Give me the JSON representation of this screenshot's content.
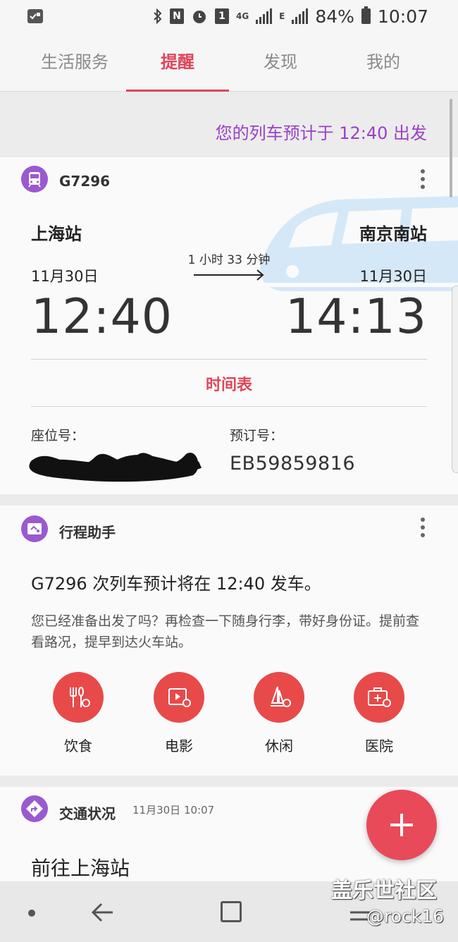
{
  "status_bar": {
    "battery": "84%",
    "time": "10:07",
    "sim_label": "1",
    "network": "4G",
    "edge_label": "E",
    "icons": [
      "notification-icon",
      "bluetooth-icon",
      "nfc-icon",
      "alarm-icon",
      "sim-icon",
      "signal-icon",
      "battery-icon"
    ]
  },
  "tabs": [
    {
      "label": "生活服务",
      "active": false
    },
    {
      "label": "提醒",
      "active": true
    },
    {
      "label": "发现",
      "active": false
    },
    {
      "label": "我的",
      "active": false
    }
  ],
  "banner": {
    "text": "您的列车预计于 12:40 出发"
  },
  "train_card": {
    "train_number": "G7296",
    "departure_station": "上海站",
    "arrival_station": "南京南站",
    "duration": "1 小时 33 分钟",
    "departure_date": "11月30日",
    "arrival_date": "11月30日",
    "departure_time": "12:40",
    "arrival_time": "14:13",
    "timetable_label": "时间表",
    "seat_label": "座位号：",
    "booking_label": "预订号：",
    "booking_number": "EB59859816"
  },
  "assistant_card": {
    "title": "行程助手",
    "message": "G7296 次列车预计将在 12:40 发车。",
    "detail": "您已经准备出发了吗？再检查一下随身行李，带好身份证。提前查看路况，提早到达火车站。",
    "shortcuts": [
      {
        "label": "饮食",
        "icon": "food-location-icon"
      },
      {
        "label": "电影",
        "icon": "movie-location-icon"
      },
      {
        "label": "休闲",
        "icon": "leisure-location-icon"
      },
      {
        "label": "医院",
        "icon": "hospital-location-icon"
      }
    ]
  },
  "traffic_card": {
    "title": "交通状况",
    "timestamp": "11月30日 10:07",
    "destination": "前往上海站"
  },
  "watermark": {
    "line1": "盖乐世社区",
    "line2": "@rock16"
  },
  "colors": {
    "accent": "#e0455a",
    "purple": "#9b3fc7",
    "poi_red": "#e84a4a"
  }
}
